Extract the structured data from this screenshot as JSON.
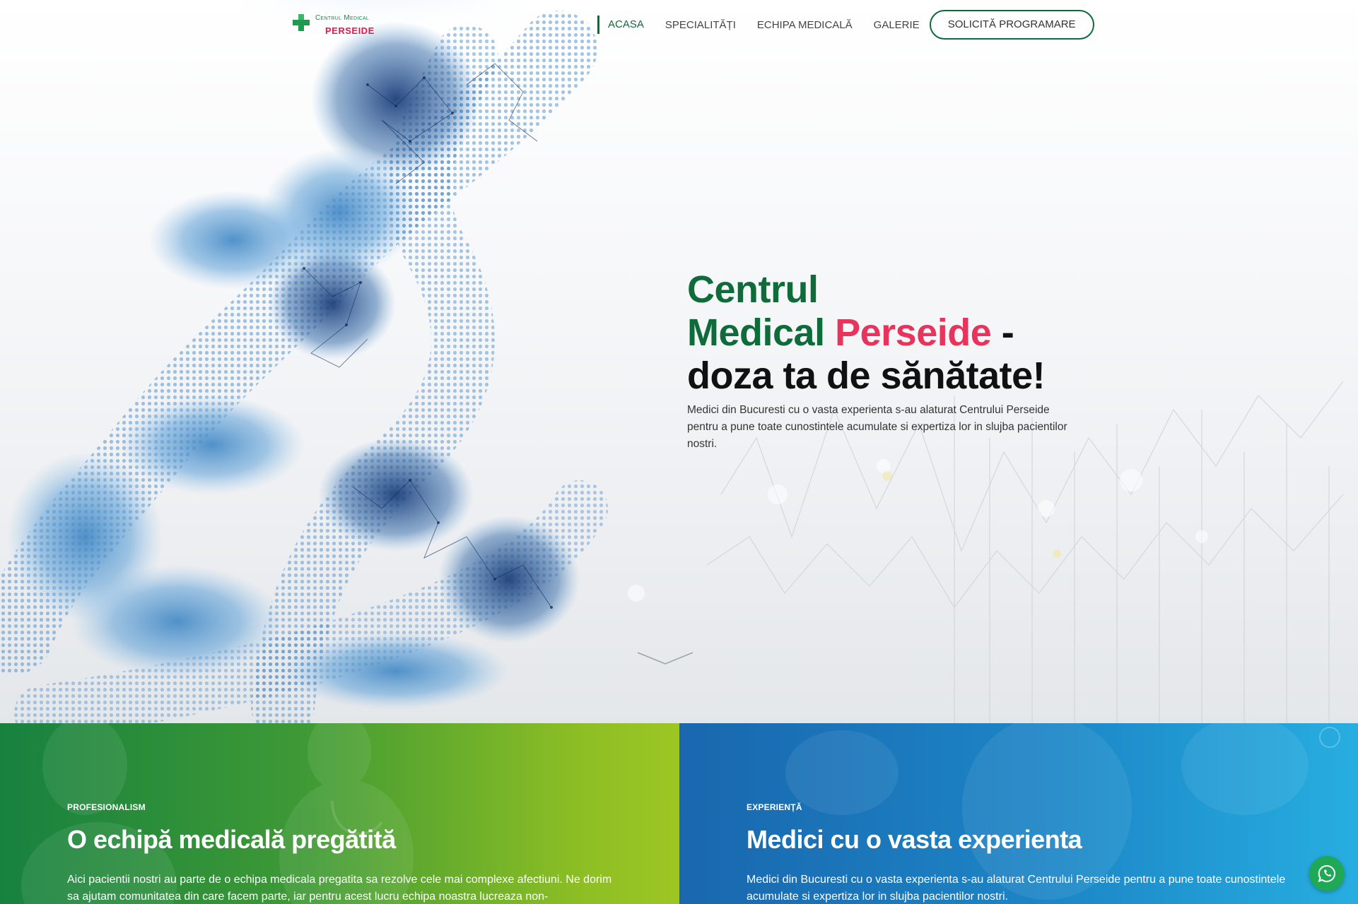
{
  "brand": {
    "logo_line1": "Centrul Medical",
    "logo_line2": "PERSEIDE",
    "logo_icon": "medical-cross-icon"
  },
  "nav": {
    "items": [
      {
        "label": "ACASA",
        "active": true
      },
      {
        "label": "SPECIALITĂȚI",
        "active": false
      },
      {
        "label": "ECHIPA MEDICALĂ",
        "active": false
      },
      {
        "label": "GALERIE",
        "active": false
      }
    ],
    "cta_label": "SOLICITĂ PROGRAMARE"
  },
  "hero": {
    "title_part1": "Centrul",
    "title_part2": "Medical",
    "title_part3": "Perseide",
    "title_part4": " -",
    "title_part5": "doza ta de sănătate!",
    "description": "Medici din Bucuresti cu o vasta experienta s-au alaturat Centrului Perseide pentru a pune toate cunostintele acumulate si expertiza lor in slujba pacientilor nostri.",
    "scroll_icon": "chevron-down-icon"
  },
  "panels": [
    {
      "kicker": "PROFESIONALISM",
      "title": "O echipă medicală pregătită",
      "text": "Aici pacientii nostri au parte de o echipa medicala pregatita sa rezolve cele mai complexe afectiuni. Ne dorim sa ajutam comunitatea din care facem parte, iar pentru acest lucru echipa noastra lucreaza non-"
    },
    {
      "kicker": "EXPERIENȚĂ",
      "title": "Medici cu o vasta experienta",
      "text": "Medici din Bucuresti cu o vasta experienta s-au alaturat Centrului Perseide pentru a pune toate cunostintele acumulate si expertiza lor in slujba pacientilor nostri."
    }
  ],
  "colors": {
    "brand_green": "#0f6b3a",
    "brand_red": "#e8345c",
    "panel_green_start": "#17813f",
    "panel_green_end": "#9dc623",
    "panel_blue_start": "#1a67ae",
    "panel_blue_end": "#27aee0",
    "whatsapp_green": "#1fa855"
  },
  "floating": {
    "whatsapp_icon": "whatsapp-icon"
  }
}
